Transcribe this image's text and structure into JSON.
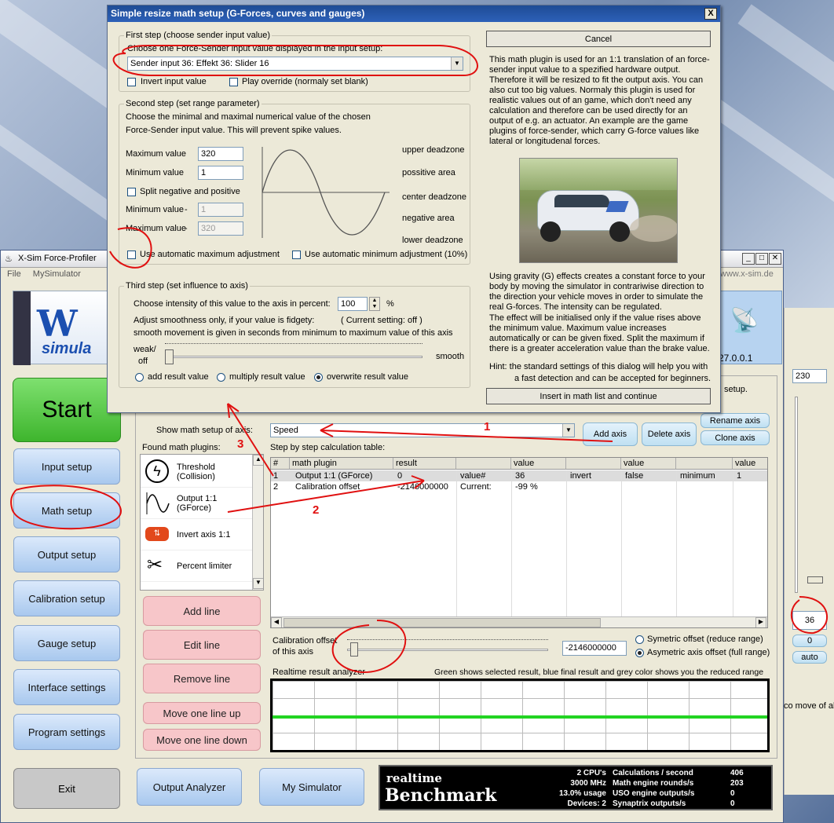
{
  "main_window": {
    "title": "X-Sim Force-Profiler",
    "url": "www.x-sim.de",
    "menu": [
      "File",
      "MySimulator"
    ],
    "version": "27.0.0.1",
    "nav": [
      "Start",
      "Input setup",
      "Math setup",
      "Output setup",
      "Calibration setup",
      "Gauge setup",
      "Interface settings",
      "Program settings",
      "Exit"
    ],
    "bottom_buttons": {
      "output_analyzer": "Output Analyzer",
      "my_simulator": "My Simulator"
    },
    "setup_partial": "setup.",
    "show_axis_label": "Show math setup of axis:",
    "axis_value": "Speed",
    "add_axis": "Add axis",
    "delete_axis": "Delete axis",
    "rename_axis": "Rename axis",
    "clone_axis": "Clone axis",
    "found_plugins_label": "Found math plugins:",
    "plugins": [
      "Threshold (Collision)",
      "Output 1:1 (GForce)",
      "Invert axis 1:1",
      "Percent limiter"
    ],
    "table_label": "Step by step calculation table:",
    "table": {
      "headers": [
        "#",
        "math plugin",
        "result",
        "",
        "value",
        "",
        "value",
        "",
        "value"
      ],
      "rows": [
        [
          "1",
          "Output 1:1 (GForce)",
          "0",
          "value#",
          "36",
          "invert",
          "false",
          "minimum",
          "1"
        ],
        [
          "2",
          "Calibration offset",
          "-2146000000",
          "Current:",
          "-99 %",
          "",
          "",
          "",
          ""
        ]
      ]
    },
    "line_buttons": [
      "Add line",
      "Edit line",
      "Remove line",
      "Move one line up",
      "Move one line down"
    ],
    "calibration_label1": "Calibration offset",
    "calibration_label2": "of this axis",
    "calibration_value": "-2146000000",
    "symetric_offset": "Symetric offset (reduce range)",
    "asymetric_offset": "Asymetric axis offset (full range)",
    "analyzer_label": "Realtime result analyzer",
    "analyzer_hint": "Green shows selected result, blue final result and grey color shows you the reduced range",
    "right_panel": {
      "top_value": "230",
      "value_36": "36",
      "value_0": "0",
      "auto": "auto",
      "move_text": "co move of all"
    },
    "benchmark": {
      "title1": "realtime",
      "title2": "Benchmark",
      "cpus": "2 CPU's",
      "mhz": "3000 MHz",
      "usage": "13.0% usage",
      "devices": "Devices: 2",
      "labels": [
        "Calculations / second",
        "Math engine rounds/s",
        "USO engine outputs/s",
        "Synaptrix outputs/s"
      ],
      "values": [
        "406",
        "203",
        "0",
        "0"
      ]
    }
  },
  "dialog": {
    "title": "Simple resize math setup (G-Forces, curves and gauges)",
    "close": "X",
    "first_step": {
      "label": "First step (choose sender input value)",
      "instruction": "Choose one Force-Sender input value displayed in the input setup:",
      "selected": "Sender input 36: Effekt 36: Slider 16",
      "invert": "Invert input value",
      "play_override": "Play override (normaly set blank)"
    },
    "second_step": {
      "label": "Second step (set range parameter)",
      "text1": "Choose the minimal and maximal numerical value of the chosen",
      "text2": "Force-Sender input value. This will prevent spike values.",
      "max_label": "Maximum value",
      "max_value": "320",
      "min_label": "Minimum value",
      "min_value": "1",
      "split": "Split negative and positive",
      "min2_label": "Minimum value",
      "min2_value": "1",
      "max2_label": "Maximum value",
      "max2_value": "320",
      "zones": [
        "upper deadzone",
        "possitive area",
        "center deadzone",
        "negative area",
        "lower deadzone"
      ],
      "auto_max": "Use automatic maximum adjustment",
      "auto_min": "Use automatic minimum adjustment (10%)"
    },
    "third_step": {
      "label": "Third step (set influence to axis)",
      "intensity_label": "Choose intensity of this value to the axis in percent:",
      "intensity_value": "100",
      "percent": "%",
      "smooth_text1": "Adjust smoothness only, if your value is fidgety:",
      "smooth_current": "( Current setting: off )",
      "smooth_text2": "smooth movement is given in seconds from minimum to maximum value of this axis",
      "weak": "weak/",
      "off": "off",
      "smooth": "smooth",
      "add_result": "add result value",
      "multiply_result": "multiply result value",
      "overwrite_result": "overwrite result value"
    },
    "cancel": "Cancel",
    "description1": "This math plugin is used for an 1:1 translation of an force-sender input value to a spezified hardware output. Therefore it will be resized to fit the output axis. You can also cut too big values. Normaly this plugin is used for realistic values out of an game, which don't need any calculation and therefore can be used directly for an output of e.g. an actuator. An example are the game plugins of force-sender, which carry G-force values like lateral or longitudenal forces.",
    "description2": "Using gravity (G) effects creates a constant force to your body by moving the simulator in contrariwise direction to the direction your vehicle moves in order to simulate the real G-forces. The intensity can be regulated.",
    "description3": "The effect will be initialised only if the value rises above the minimum value. Maximum value increases automatically or can be given fixed. Split the maximum if there is a greater acceleration value than the brake value.",
    "hint1": "Hint: the standard settings of this dialog will help you with",
    "hint2": "a fast detection and can be accepted for beginners.",
    "insert_button": "Insert in math list and continue"
  },
  "annotations": [
    "1",
    "2",
    "3"
  ]
}
